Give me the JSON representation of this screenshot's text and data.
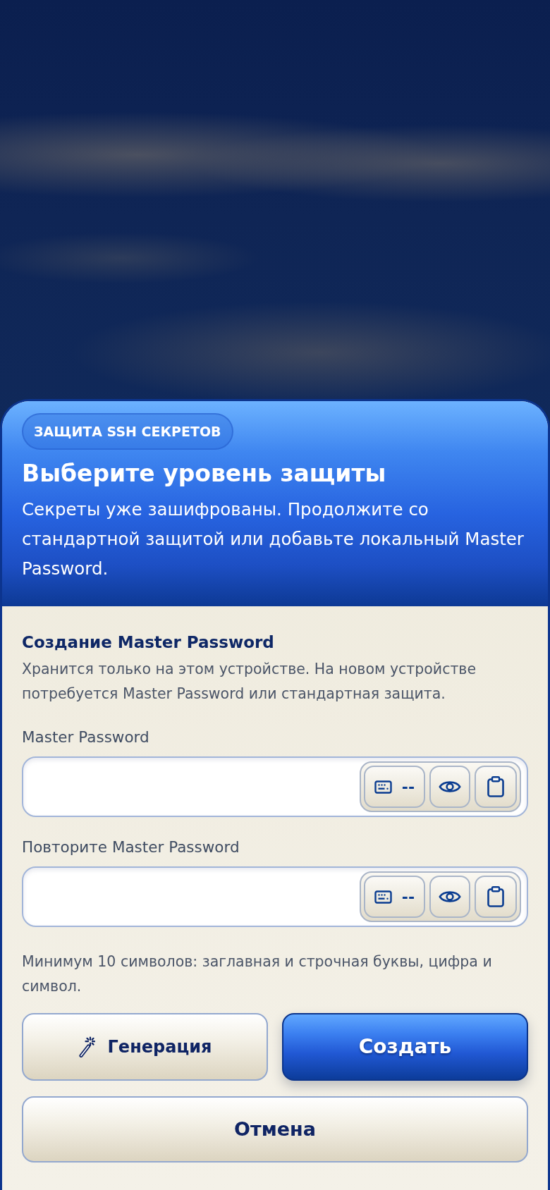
{
  "header": {
    "badge": "ЗАЩИТА SSH СЕКРЕТОВ",
    "title": "Выберите уровень защиты",
    "description": "Секреты уже зашифрованы. Продолжите со стандартной защитой или добавьте локальный Master Password."
  },
  "section": {
    "title": "Создание Master Password",
    "description": "Хранится только на этом устройстве. На новом устройстве потребуется Master Password или стандартная защита."
  },
  "fields": [
    {
      "label": "Master Password",
      "tools": [
        {
          "kind": "keyboard",
          "text": "--"
        },
        {
          "kind": "reveal"
        },
        {
          "kind": "paste"
        }
      ]
    },
    {
      "label": "Повторите Master Password",
      "tools": [
        {
          "kind": "keyboard",
          "text": "--"
        },
        {
          "kind": "reveal"
        },
        {
          "kind": "paste"
        }
      ]
    }
  ],
  "hint": "Минимум 10 символов: заглавная и строчная буквы, цифра и символ.",
  "actions": [
    {
      "kind": "generate",
      "label": "Генерация"
    },
    {
      "kind": "submit",
      "label": "Создать"
    },
    {
      "kind": "cancel",
      "label": "Отмена"
    }
  ]
}
